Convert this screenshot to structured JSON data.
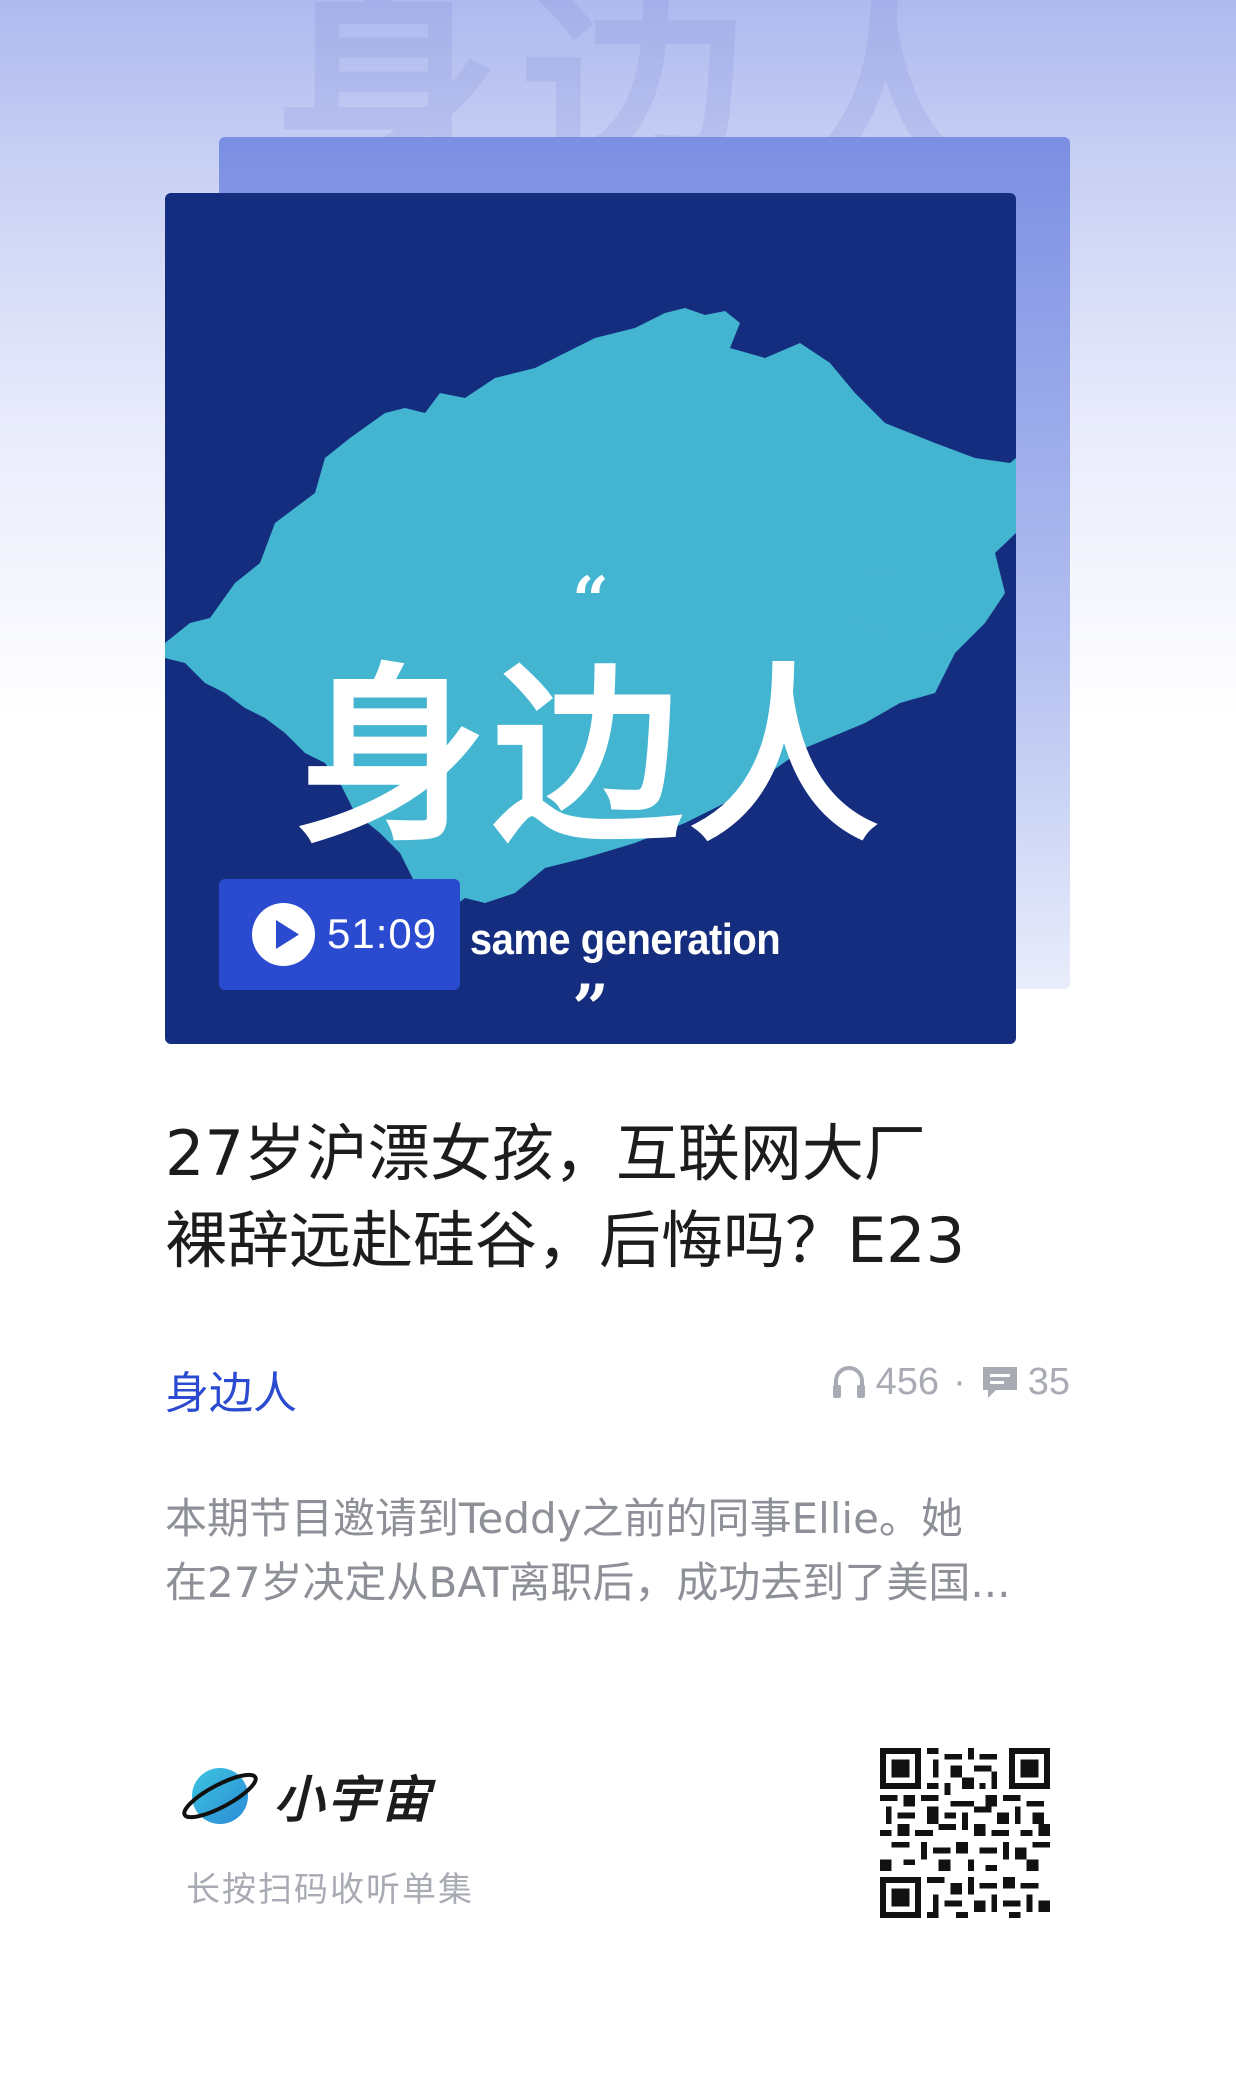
{
  "watermark": "身边人",
  "cover": {
    "title": "身边人",
    "subtitle": "the same generation",
    "quote_open": "“",
    "quote_close": "”",
    "play_icon": "play-icon",
    "duration": "51:09"
  },
  "episode": {
    "title_line1": "27岁沪漂女孩，互联网大厂",
    "title_line2": "裸辞远赴硅谷，后悔吗？E23"
  },
  "podcast": {
    "name": "身边人"
  },
  "stats": {
    "plays_icon": "headphones-icon",
    "plays": "456",
    "separator": "·",
    "comments_icon": "comment-icon",
    "comments": "35"
  },
  "description": {
    "line1": "本期节目邀请到Teddy之前的同事Ellie。她",
    "line2": "在27岁决定从BAT离职后，成功去到了美国..."
  },
  "footer": {
    "brand_name": "小宇宙",
    "brand_icon": "planet-logo-icon",
    "scan_hint": "长按扫码收听单集",
    "qr_icon": "qr-code-icon"
  },
  "colors": {
    "accent": "#2a4bd0",
    "cover_bg": "#142d7e",
    "splash": "#44b5d1",
    "title_text": "#1c1c1f",
    "muted_text": "#8e9097"
  }
}
